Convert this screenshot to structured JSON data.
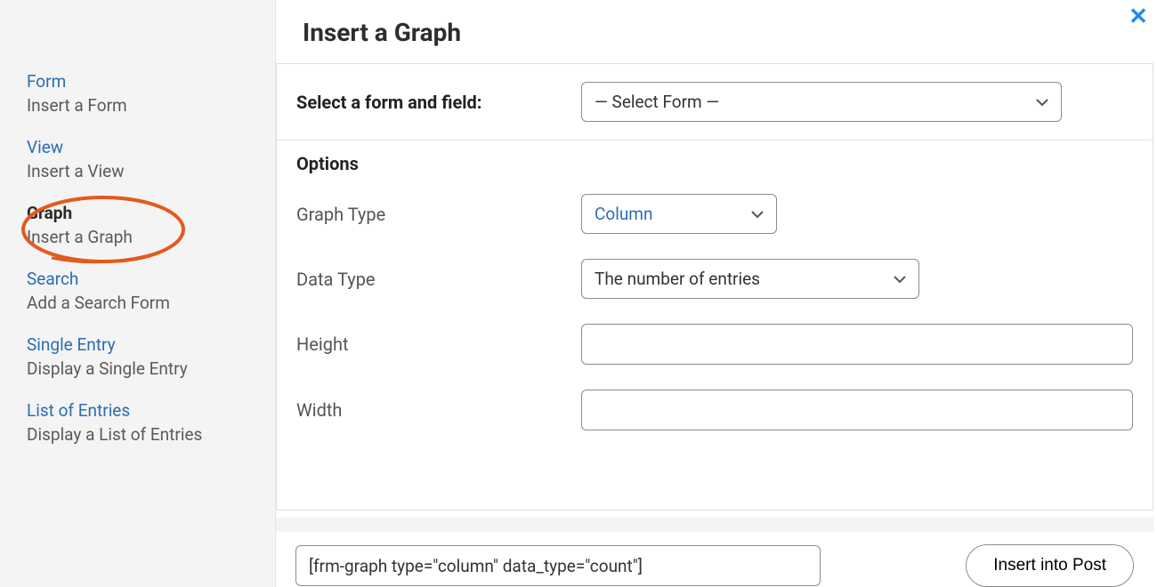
{
  "header": {
    "title": "Insert a Graph"
  },
  "sidebar": {
    "items": [
      {
        "title": "Form",
        "sub": "Insert a Form"
      },
      {
        "title": "View",
        "sub": "Insert a View"
      },
      {
        "title": "Graph",
        "sub": "Insert a Graph"
      },
      {
        "title": "Search",
        "sub": "Add a Search Form"
      },
      {
        "title": "Single Entry",
        "sub": "Display a Single Entry"
      },
      {
        "title": "List of Entries",
        "sub": "Display a List of Entries"
      }
    ]
  },
  "form": {
    "select_label": "Select a form and field:",
    "select_form_value": "— Select Form —",
    "options_heading": "Options",
    "graph_type_label": "Graph Type",
    "graph_type_value": "Column",
    "data_type_label": "Data Type",
    "data_type_value": "The number of entries",
    "height_label": "Height",
    "height_value": "",
    "width_label": "Width",
    "width_value": ""
  },
  "footer": {
    "shortcode": "[frm-graph type=\"column\" data_type=\"count\"]",
    "insert_label": "Insert into Post"
  },
  "colors": {
    "link": "#2b6db3",
    "accent": "#1f8ded",
    "annotation": "#e35a1d"
  }
}
